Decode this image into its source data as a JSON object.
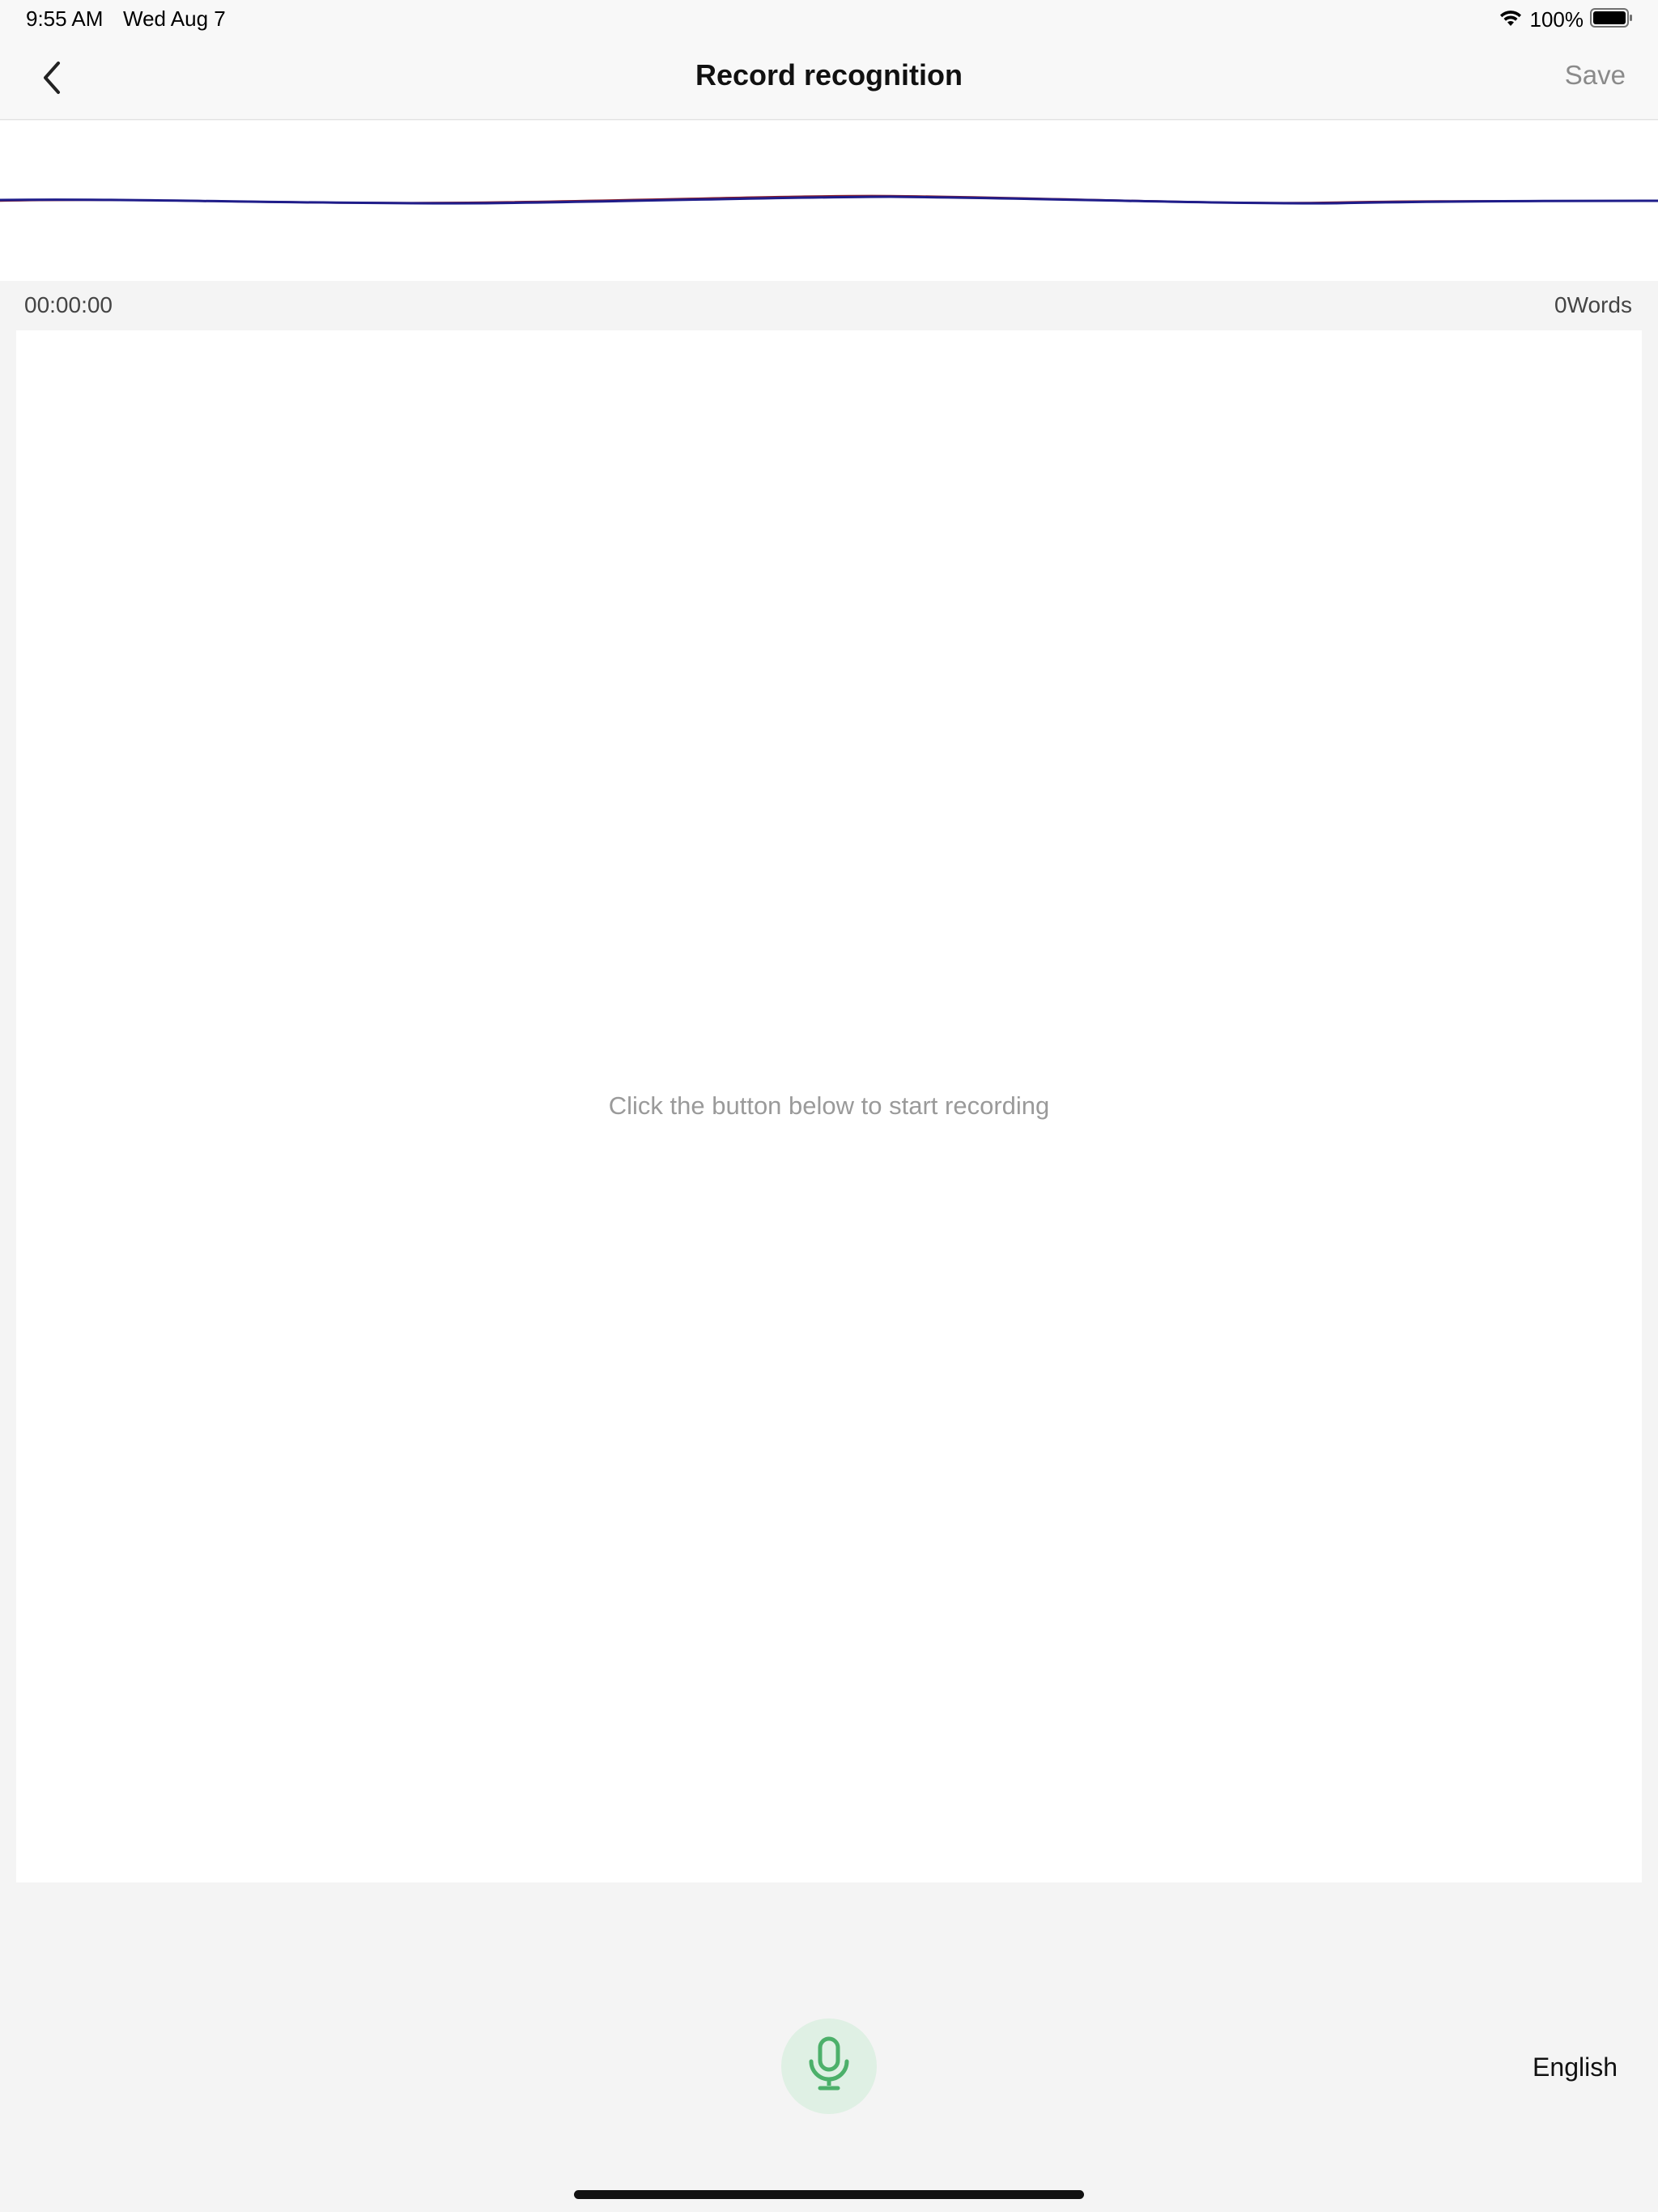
{
  "status_bar": {
    "time": "9:55 AM",
    "date": "Wed Aug 7",
    "battery_percent": "100%",
    "battery_level": 1.0,
    "wifi_icon": "wifi-icon",
    "battery_icon": "battery-icon"
  },
  "nav": {
    "title": "Record recognition",
    "back_icon": "chevron-left-icon",
    "save_label": "Save"
  },
  "recording": {
    "elapsed": "00:00:00",
    "word_count": "0Words",
    "hint": "Click the button below to start recording"
  },
  "controls": {
    "mic_icon": "microphone-icon",
    "language": "English"
  },
  "colors": {
    "accent_green": "#4cb06a",
    "mic_bg": "#dff0e4",
    "wave_blue": "#1f1d8a",
    "wave_red": "#8a1d2a",
    "save_gray": "#8a8a8a",
    "hint_gray": "#9a9a9a"
  }
}
